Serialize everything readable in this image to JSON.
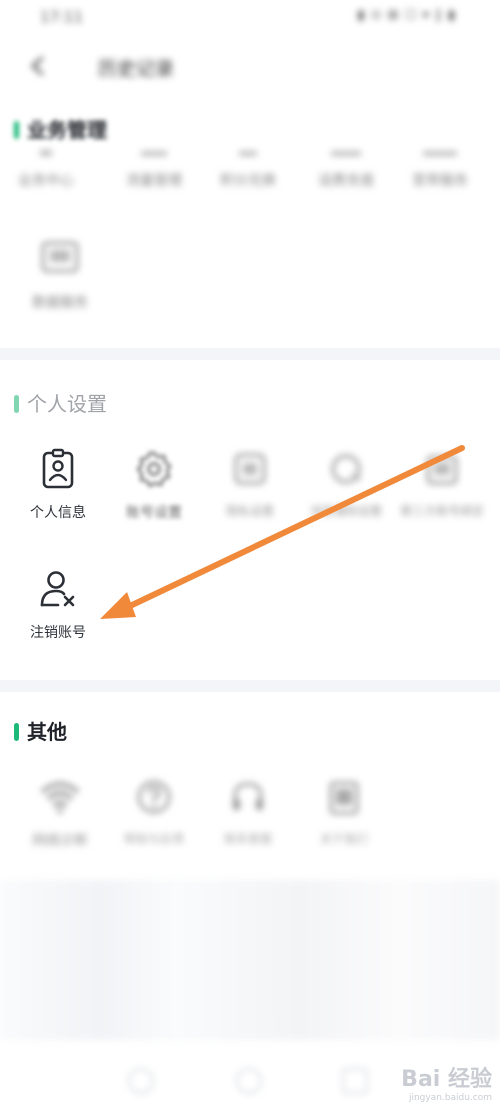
{
  "status_bar": {
    "time": "17:11",
    "indicators": "▮ ⊙ ⊠ ☐ ▾ ∥ ▮"
  },
  "header": {
    "title": "历史记录",
    "back_icon": "arrow-left-icon"
  },
  "sections": {
    "section1": {
      "title": "业务管理",
      "items": [
        {
          "label": "业务中心",
          "icon": "grid-icon"
        },
        {
          "label": "流量管理",
          "icon": "chart-icon"
        },
        {
          "label": "积分兑换",
          "icon": "gift-icon"
        },
        {
          "label": "话费充值",
          "icon": "wallet-icon"
        },
        {
          "label": "宽带服务",
          "icon": "router-icon"
        },
        {
          "label": "数据服务",
          "icon": "monitor-icon"
        }
      ]
    },
    "personal": {
      "title": "个人设置",
      "items": [
        {
          "label": "个人信息",
          "icon": "id-badge-icon"
        },
        {
          "label": "账号设置",
          "icon": "gear-icon"
        },
        {
          "label": "隐私设置",
          "icon": "shield-icon"
        },
        {
          "label": "消息通知设置",
          "icon": "bell-icon"
        },
        {
          "label": "第三方账号绑定",
          "icon": "link-icon"
        },
        {
          "label": "注销账号",
          "icon": "user-remove-icon"
        }
      ]
    },
    "other": {
      "title": "其他",
      "items": [
        {
          "label": "网络诊断",
          "icon": "wifi-icon"
        },
        {
          "label": "帮助与反馈",
          "icon": "question-icon"
        },
        {
          "label": "联系客服",
          "icon": "headset-icon"
        },
        {
          "label": "关于我们",
          "icon": "info-icon"
        }
      ]
    }
  },
  "watermark": {
    "brand": "Bai 经验",
    "url": "jingyan.baidu.com"
  },
  "colors": {
    "accent": "#1db97a",
    "arrow": "#f0893a",
    "divider": "#f4f5f8"
  }
}
